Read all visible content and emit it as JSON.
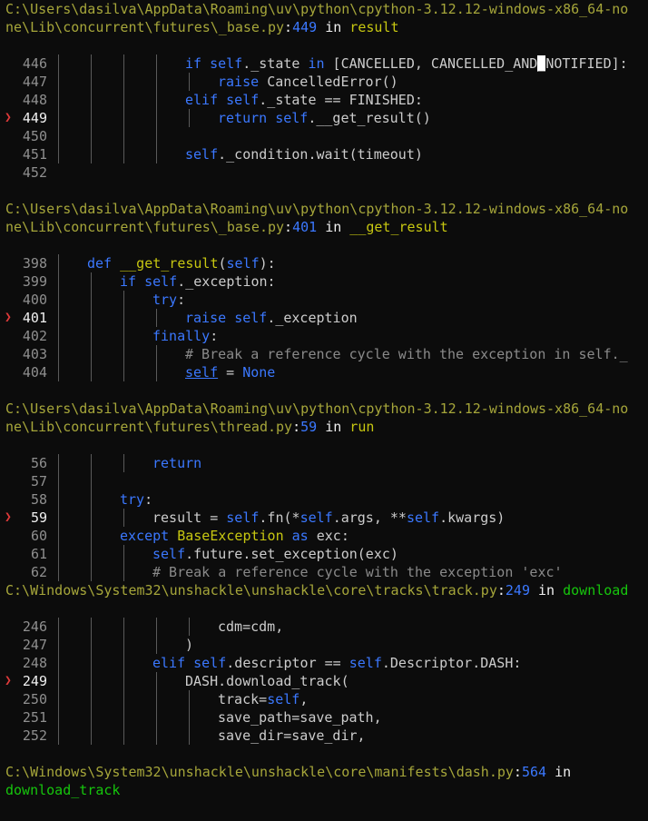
{
  "frames": [
    {
      "path_lines": [
        "C:\\Users\\dasilva\\AppData\\Roaming\\uv\\python\\cpython-3.12.12-windows-x86_64-no",
        "ne\\Lib\\concurrent\\futures\\_base.py"
      ],
      "lineno": "449",
      "in_word": "in",
      "func": "result",
      "lines": [
        {
          "n": "446",
          "depth": 4,
          "cur": false,
          "tokens": [
            {
              "t": "if ",
              "c": "k"
            },
            {
              "t": "self",
              "c": "sf"
            },
            {
              "t": "._state ",
              "c": ""
            },
            {
              "t": "in",
              "c": "k"
            },
            {
              "t": " [CANCELLED, CANCELLED_AND",
              "c": ""
            },
            {
              "t": "_",
              "c": "cursor"
            },
            {
              "t": "NOTIFIED]:",
              "c": ""
            }
          ]
        },
        {
          "n": "447",
          "depth": 5,
          "cur": false,
          "tokens": [
            {
              "t": "raise ",
              "c": "k"
            },
            {
              "t": "CancelledError()",
              "c": ""
            }
          ]
        },
        {
          "n": "448",
          "depth": 4,
          "cur": false,
          "tokens": [
            {
              "t": "elif ",
              "c": "k"
            },
            {
              "t": "self",
              "c": "sf"
            },
            {
              "t": "._state == FINISHED:",
              "c": ""
            }
          ]
        },
        {
          "n": "449",
          "depth": 5,
          "cur": true,
          "tokens": [
            {
              "t": "return ",
              "c": "k"
            },
            {
              "t": "self",
              "c": "sf"
            },
            {
              "t": ".__get_result()",
              "c": ""
            }
          ]
        },
        {
          "n": "450",
          "depth": 4,
          "cur": false,
          "tokens": []
        },
        {
          "n": "451",
          "depth": 4,
          "cur": false,
          "tokens": [
            {
              "t": "self",
              "c": "sf"
            },
            {
              "t": "._condition.wait(timeout)",
              "c": ""
            }
          ]
        },
        {
          "n": "452",
          "depth": 0,
          "cur": false,
          "tokens": []
        }
      ]
    },
    {
      "path_lines": [
        "C:\\Users\\dasilva\\AppData\\Roaming\\uv\\python\\cpython-3.12.12-windows-x86_64-no",
        "ne\\Lib\\concurrent\\futures\\_base.py"
      ],
      "lineno": "401",
      "in_word": "in",
      "func": "__get_result",
      "lines": [
        {
          "n": "398",
          "depth": 1,
          "cur": false,
          "tokens": [
            {
              "t": "def ",
              "c": "k"
            },
            {
              "t": "__get_result",
              "c": "fn"
            },
            {
              "t": "(",
              "c": ""
            },
            {
              "t": "self",
              "c": "sf"
            },
            {
              "t": "):",
              "c": ""
            }
          ]
        },
        {
          "n": "399",
          "depth": 2,
          "cur": false,
          "tokens": [
            {
              "t": "if ",
              "c": "k"
            },
            {
              "t": "self",
              "c": "sf"
            },
            {
              "t": "._exception:",
              "c": ""
            }
          ]
        },
        {
          "n": "400",
          "depth": 3,
          "cur": false,
          "tokens": [
            {
              "t": "try",
              "c": "k"
            },
            {
              "t": ":",
              "c": ""
            }
          ]
        },
        {
          "n": "401",
          "depth": 4,
          "cur": true,
          "tokens": [
            {
              "t": "raise ",
              "c": "k"
            },
            {
              "t": "self",
              "c": "sf"
            },
            {
              "t": "._exception",
              "c": ""
            }
          ]
        },
        {
          "n": "402",
          "depth": 3,
          "cur": false,
          "tokens": [
            {
              "t": "finally",
              "c": "k"
            },
            {
              "t": ":",
              "c": ""
            }
          ]
        },
        {
          "n": "403",
          "depth": 4,
          "cur": false,
          "tokens": [
            {
              "t": "# Break a reference cycle with the exception in self._",
              "c": "cm"
            }
          ]
        },
        {
          "n": "404",
          "depth": 4,
          "cur": false,
          "tokens": [
            {
              "t": "self",
              "c": "sf ul"
            },
            {
              "t": " = ",
              "c": ""
            },
            {
              "t": "None",
              "c": "k"
            }
          ]
        }
      ]
    },
    {
      "path_lines": [
        "C:\\Users\\dasilva\\AppData\\Roaming\\uv\\python\\cpython-3.12.12-windows-x86_64-no",
        "ne\\Lib\\concurrent\\futures\\thread.py"
      ],
      "lineno": "59",
      "in_word": "in",
      "func": "run",
      "lines": [
        {
          "n": "56",
          "depth": 3,
          "cur": false,
          "tokens": [
            {
              "t": "return",
              "c": "k"
            }
          ]
        },
        {
          "n": "57",
          "depth": 2,
          "cur": false,
          "tokens": []
        },
        {
          "n": "58",
          "depth": 2,
          "cur": false,
          "tokens": [
            {
              "t": "try",
              "c": "k"
            },
            {
              "t": ":",
              "c": ""
            }
          ]
        },
        {
          "n": "59",
          "depth": 3,
          "cur": true,
          "tokens": [
            {
              "t": "result = ",
              "c": ""
            },
            {
              "t": "self",
              "c": "sf"
            },
            {
              "t": ".fn(*",
              "c": ""
            },
            {
              "t": "self",
              "c": "sf"
            },
            {
              "t": ".args, **",
              "c": ""
            },
            {
              "t": "self",
              "c": "sf"
            },
            {
              "t": ".kwargs)",
              "c": ""
            }
          ]
        },
        {
          "n": "60",
          "depth": 2,
          "cur": false,
          "tokens": [
            {
              "t": "except ",
              "c": "k"
            },
            {
              "t": "BaseException",
              "c": "fn"
            },
            {
              "t": " as ",
              "c": "k"
            },
            {
              "t": "exc:",
              "c": ""
            }
          ]
        },
        {
          "n": "61",
          "depth": 3,
          "cur": false,
          "tokens": [
            {
              "t": "self",
              "c": "sf"
            },
            {
              "t": ".future.set_exception(exc)",
              "c": ""
            }
          ]
        },
        {
          "n": "62",
          "depth": 3,
          "cur": false,
          "tokens": [
            {
              "t": "# Break a reference cycle with the exception 'exc'",
              "c": "cm"
            }
          ]
        }
      ]
    },
    {
      "path_lines": [
        "C:\\Windows\\System32\\unshackle\\unshackle\\core\\tracks\\track.py"
      ],
      "lineno": "249",
      "in_word": "in",
      "func": "download",
      "func_class": "dlname",
      "lines": [
        {
          "n": "246",
          "depth": 5,
          "cur": false,
          "tokens": [
            {
              "t": "cdm=cdm,",
              "c": ""
            }
          ]
        },
        {
          "n": "247",
          "depth": 4,
          "cur": false,
          "tokens": [
            {
              "t": ")",
              "c": ""
            }
          ]
        },
        {
          "n": "248",
          "depth": 3,
          "cur": false,
          "tokens": [
            {
              "t": "elif ",
              "c": "k"
            },
            {
              "t": "self",
              "c": "sf"
            },
            {
              "t": ".descriptor == ",
              "c": ""
            },
            {
              "t": "self",
              "c": "sf"
            },
            {
              "t": ".Descriptor.DASH:",
              "c": ""
            }
          ]
        },
        {
          "n": "249",
          "depth": 4,
          "cur": true,
          "tokens": [
            {
              "t": "DASH.download_track(",
              "c": ""
            }
          ]
        },
        {
          "n": "250",
          "depth": 5,
          "cur": false,
          "tokens": [
            {
              "t": "track=",
              "c": ""
            },
            {
              "t": "self",
              "c": "sf"
            },
            {
              "t": ",",
              "c": ""
            }
          ]
        },
        {
          "n": "251",
          "depth": 5,
          "cur": false,
          "tokens": [
            {
              "t": "save_path=save_path,",
              "c": ""
            }
          ]
        },
        {
          "n": "252",
          "depth": 5,
          "cur": false,
          "tokens": [
            {
              "t": "save_dir=save_dir,",
              "c": ""
            }
          ]
        }
      ]
    },
    {
      "path_lines": [
        "C:\\Windows\\System32\\unshackle\\unshackle\\core\\manifests\\dash.py"
      ],
      "lineno": "564",
      "in_word": "in",
      "func": "download_track",
      "func_class": "dlname",
      "func_on_next_line": true,
      "lines": []
    }
  ],
  "colors": {
    "background": "#0c0c0c",
    "path": "#a6a63a",
    "keyword": "#3b78ff",
    "function": "#c7c711",
    "comment": "#8a8a8a",
    "marker": "#e03a3a"
  },
  "marker_glyph": "❯"
}
